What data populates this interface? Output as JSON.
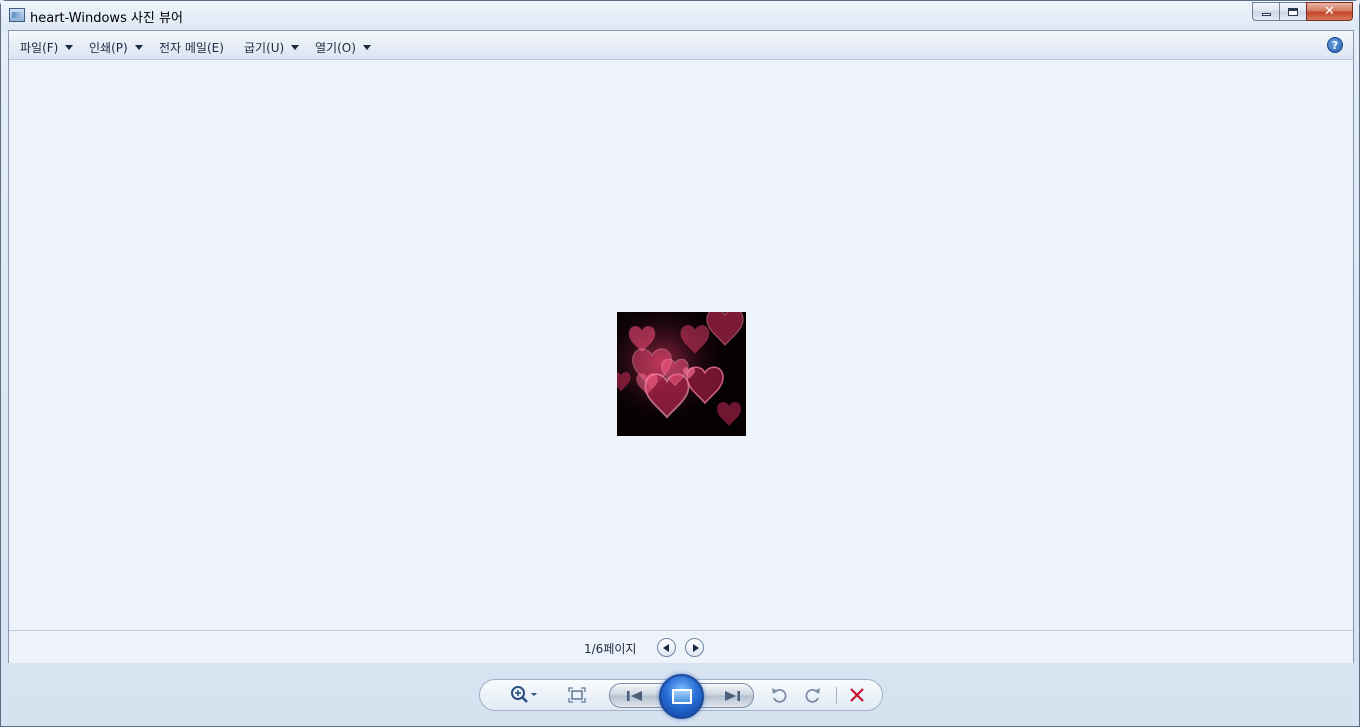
{
  "window": {
    "title": "heart-Windows 사진 뷰어",
    "minimize_label": "minimize",
    "maximize_label": "maximize",
    "close_label": "✕"
  },
  "menu": {
    "items": [
      {
        "label": "파일(F)",
        "has_arrow": true
      },
      {
        "label": "인쇄(P)",
        "has_arrow": true
      },
      {
        "label": "전자 메일(E)",
        "has_arrow": false
      },
      {
        "label": "굽기(U)",
        "has_arrow": true
      },
      {
        "label": "열기(O)",
        "has_arrow": true
      }
    ],
    "help_label": "?"
  },
  "image": {
    "name": "heart",
    "description_icon": "heart-image"
  },
  "status": {
    "page_text": "1/6페이지"
  },
  "toolbar": {
    "zoom_icon": "zoom-icon",
    "fit_icon": "actual-size-icon",
    "prev_icon": "previous-icon",
    "slideshow_icon": "slideshow-icon",
    "next_icon": "next-icon",
    "rotate_ccw_icon": "rotate-counterclockwise-icon",
    "rotate_cw_icon": "rotate-clockwise-icon",
    "delete_icon": "delete-icon"
  },
  "colors": {
    "accent": "#1e4c9a",
    "delete": "#c8102e",
    "heart_pink": "#ff4f7d"
  }
}
